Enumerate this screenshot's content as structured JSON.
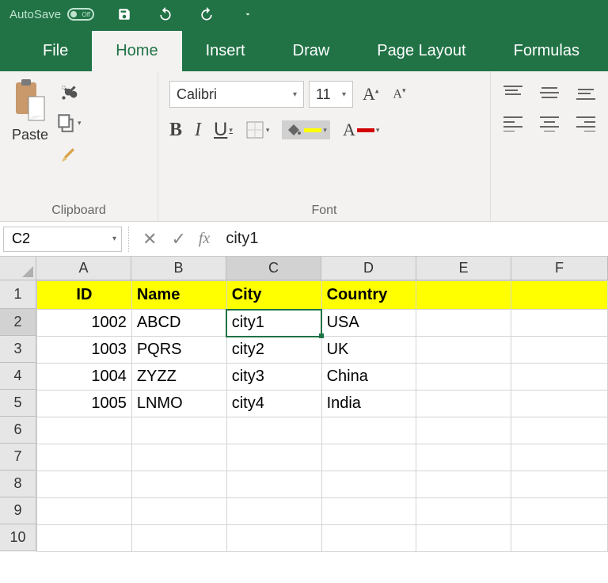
{
  "qat": {
    "autosave_label": "AutoSave",
    "autosave_state": "Off"
  },
  "tabs": [
    "File",
    "Home",
    "Insert",
    "Draw",
    "Page Layout",
    "Formulas"
  ],
  "active_tab": "Home",
  "ribbon": {
    "clipboard": {
      "label": "Clipboard",
      "paste": "Paste"
    },
    "font": {
      "label": "Font",
      "name": "Calibri",
      "size": "11",
      "bold": "B",
      "italic": "I",
      "underline": "U"
    }
  },
  "name_box": "C2",
  "fx_symbol": "fx",
  "formula_value": "city1",
  "columns": [
    "A",
    "B",
    "C",
    "D",
    "E",
    "F"
  ],
  "rows": [
    "1",
    "2",
    "3",
    "4",
    "5",
    "6",
    "7",
    "8",
    "9",
    "10"
  ],
  "headers": {
    "A": "ID",
    "B": "Name",
    "C": "City",
    "D": "Country"
  },
  "data": [
    {
      "A": "1002",
      "B": "ABCD",
      "C": "city1",
      "D": "USA"
    },
    {
      "A": "1003",
      "B": "PQRS",
      "C": "city2",
      "D": "UK"
    },
    {
      "A": "1004",
      "B": "ZYZZ",
      "C": "city3",
      "D": "China"
    },
    {
      "A": "1005",
      "B": "LNMO",
      "C": "city4",
      "D": "India"
    }
  ],
  "selected_cell": "C2",
  "colors": {
    "accent": "#217346",
    "header": "#ffff00"
  }
}
